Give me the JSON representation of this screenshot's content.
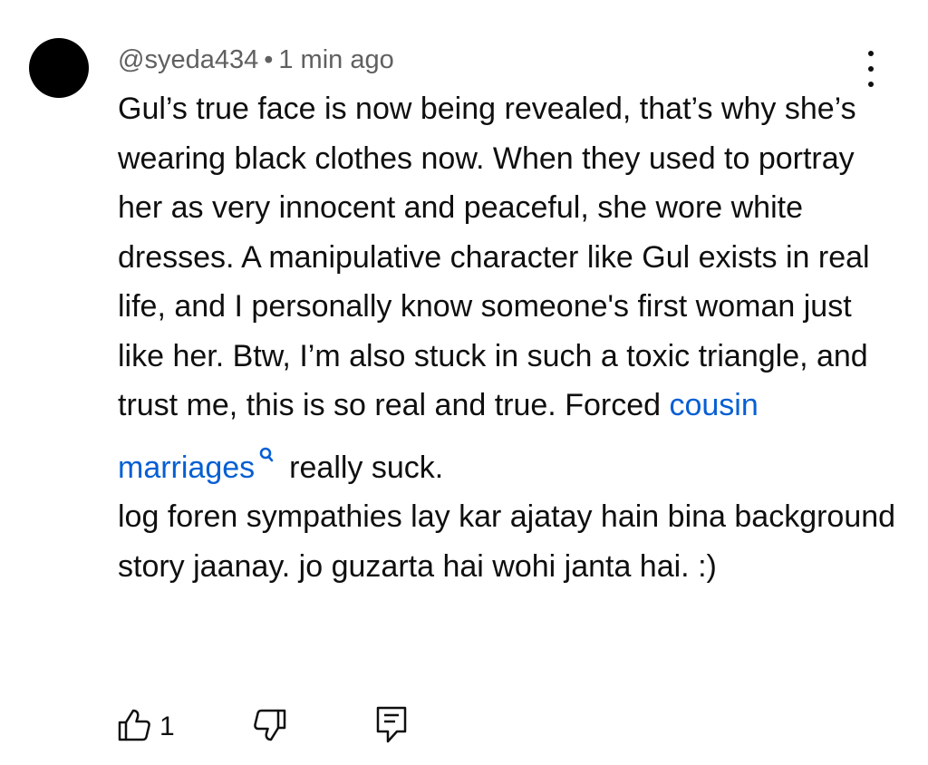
{
  "comment": {
    "handle": "@syeda434",
    "separator": "•",
    "time": "1 min ago",
    "text_before_link": "Gul’s true face is now being revealed, that’s why she’s wearing black clothes now. When they used to portray her as very innocent and peaceful, she wore white dresses. A manipulative character like Gul exists in real life, and I personally know someone's first woman just like her. Btw, I’m also stuck in such a toxic triangle, and trust me, this is so real and true. Forced ",
    "link_text": "cousin marriages",
    "text_after_link": "really suck.",
    "second_paragraph": "log foren sympathies lay kar ajatay hain bina background story jaanay. jo guzarta hai wohi janta hai. :)",
    "like_count": "1"
  },
  "icons": {
    "avatar": "avatar-circle",
    "menu": "more-vert-icon",
    "link_search": "search-icon",
    "like": "thumbs-up-icon",
    "dislike": "thumbs-down-icon",
    "reply": "reply-comment-icon"
  },
  "colors": {
    "text": "#0f0f0f",
    "meta": "#606060",
    "link": "#065fd4",
    "avatar": "#000000",
    "background": "#ffffff"
  }
}
